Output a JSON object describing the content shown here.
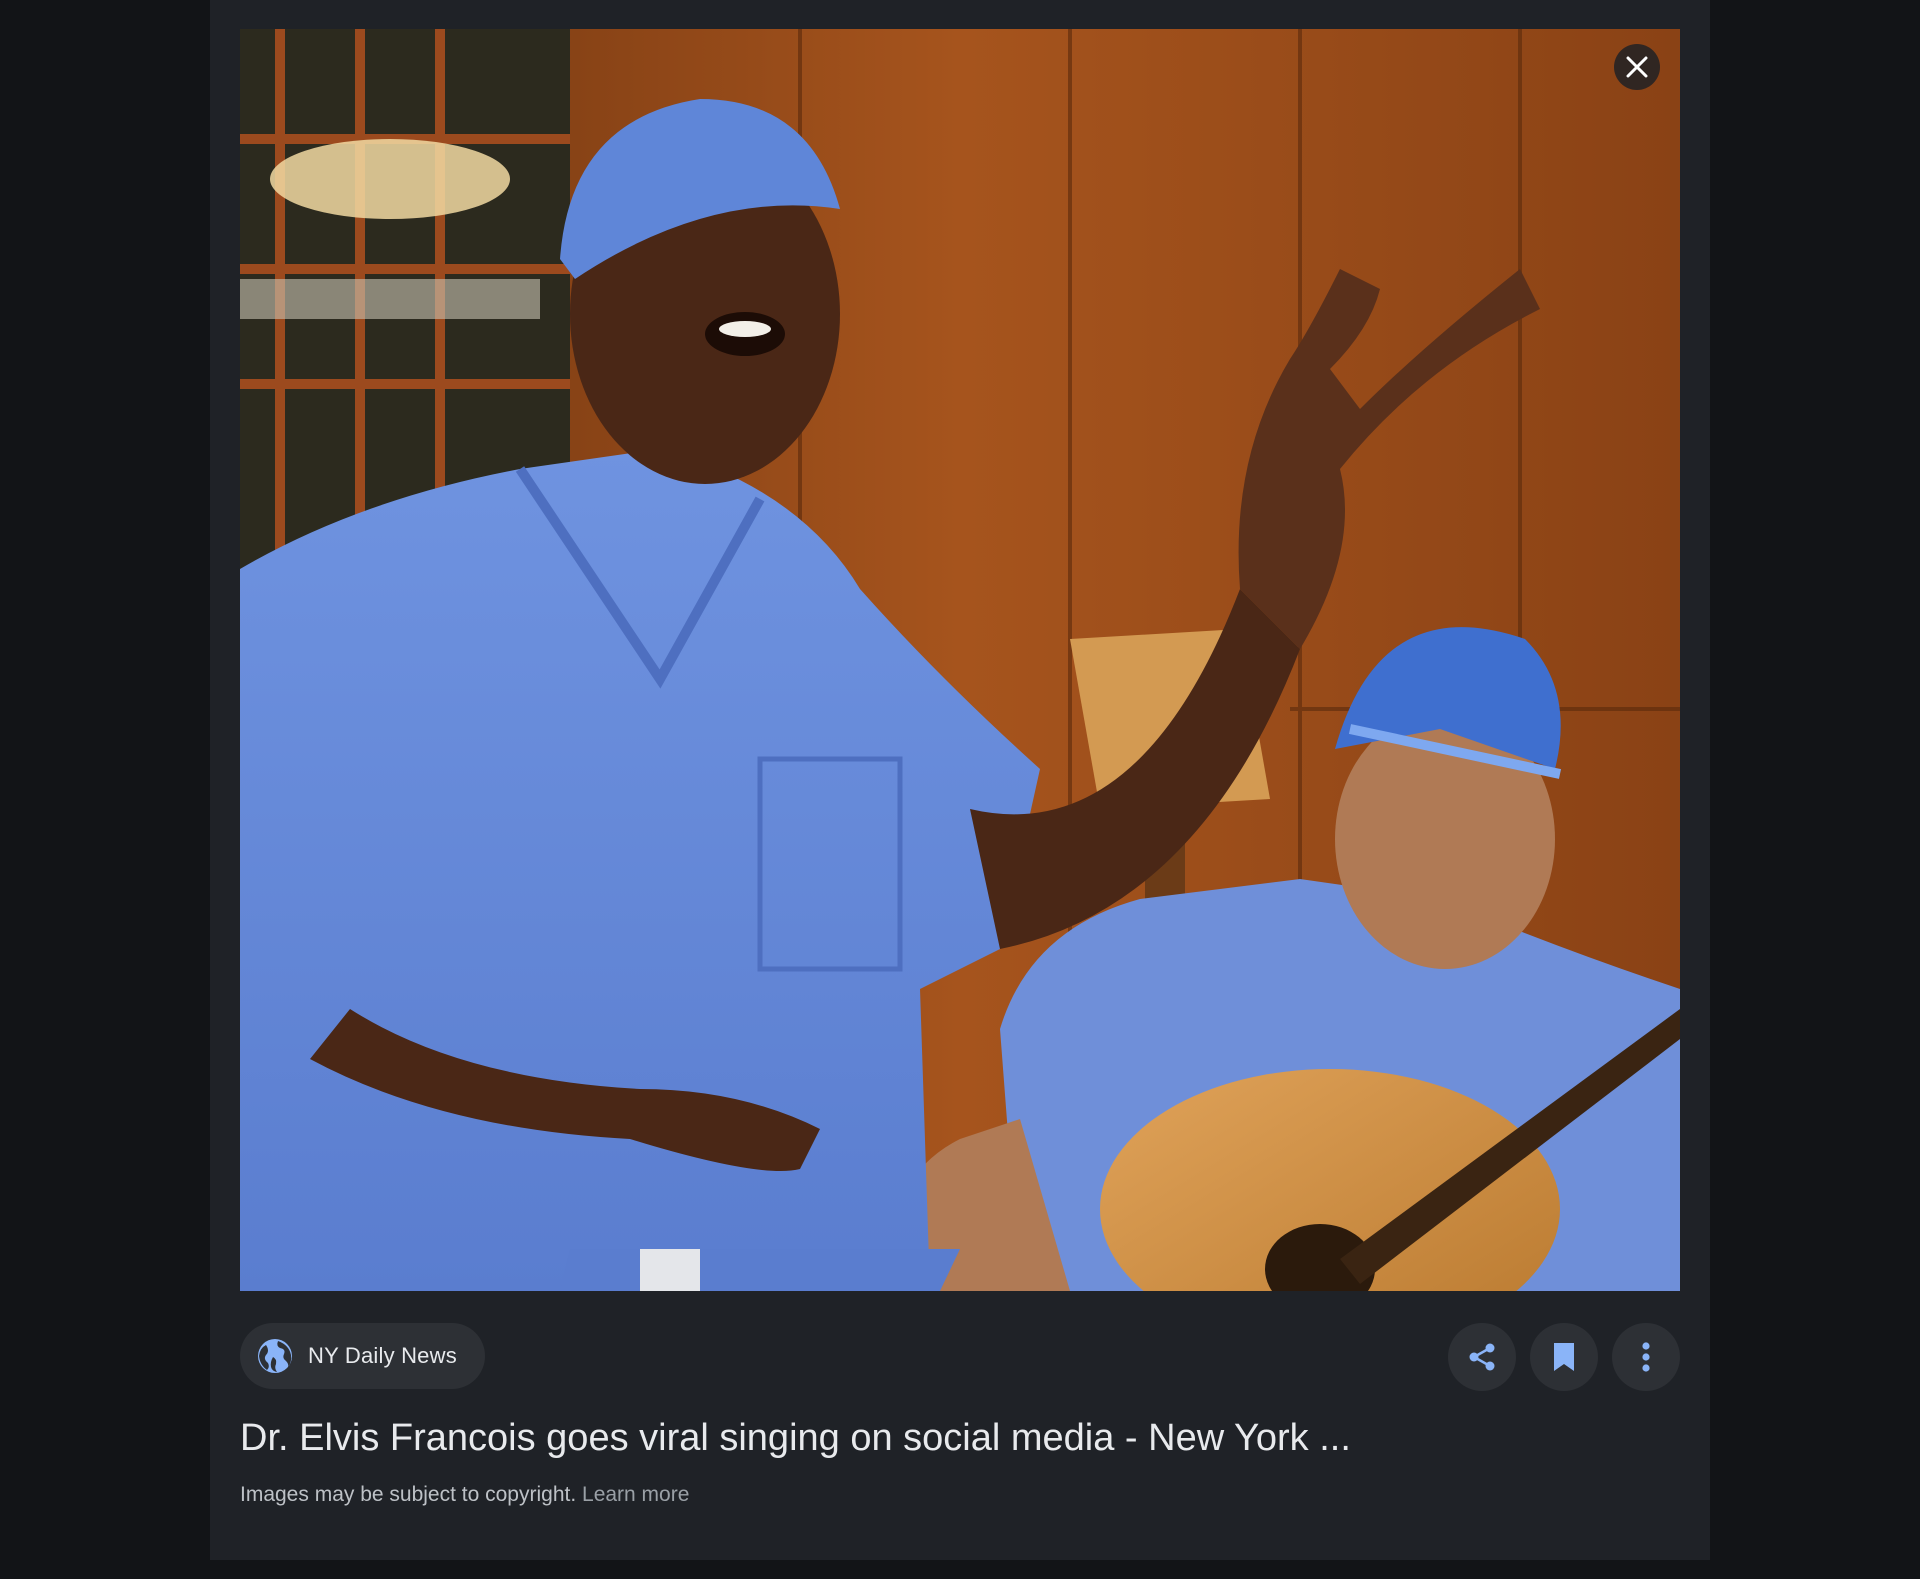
{
  "viewer": {
    "close_label": "Close",
    "image_alt": "Two surgeons in blue scrubs performing music; one sings with a raised hand while the other plays an acoustic guitar"
  },
  "source": {
    "name": "NY Daily News",
    "icon": "globe-icon"
  },
  "actions": [
    {
      "name": "share",
      "icon": "share-icon"
    },
    {
      "name": "save",
      "icon": "bookmark-icon"
    },
    {
      "name": "more",
      "icon": "more-vert-icon"
    }
  ],
  "title": "Dr. Elvis Francois goes viral singing on social media - New York ...",
  "footer": {
    "copyright_text": "Images may be subject to copyright.",
    "learn_more": "Learn more"
  },
  "colors": {
    "accent": "#8ab4f8",
    "panel_bg": "#1f2227",
    "page_bg": "#121417"
  }
}
